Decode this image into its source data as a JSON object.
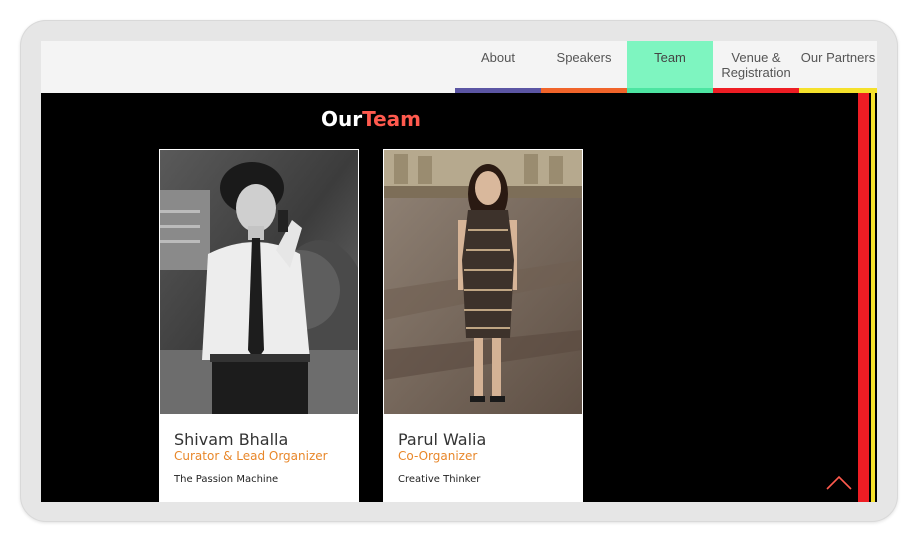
{
  "nav": {
    "items": [
      {
        "label": "About",
        "bar_color": "#5b55a3",
        "active": false
      },
      {
        "label": "Speakers",
        "bar_color": "#f0642a",
        "active": false
      },
      {
        "label": "Team",
        "bar_color": "#4de5a2",
        "active": true
      },
      {
        "label": "Venue & Registration",
        "bar_color": "#ee1d24",
        "active": false
      },
      {
        "label": "Our Partners",
        "bar_color": "#f5e12b",
        "active": false
      }
    ]
  },
  "section": {
    "title_part1": "Our",
    "title_part2": "Team",
    "title_part2_color": "#ff5a4e"
  },
  "team": [
    {
      "name": "Shivam Bhalla",
      "role": "Curator & Lead Organizer",
      "tagline": "The Passion Machine"
    },
    {
      "name": "Parul Walia",
      "role": "Co-Organizer",
      "tagline": "Creative Thinker"
    }
  ],
  "colors": {
    "role_text": "#e8872a",
    "accent_red": "#ee1d24",
    "accent_yellow": "#f5e12b"
  },
  "icons": {
    "scroll_top": "chevron-up-icon"
  }
}
